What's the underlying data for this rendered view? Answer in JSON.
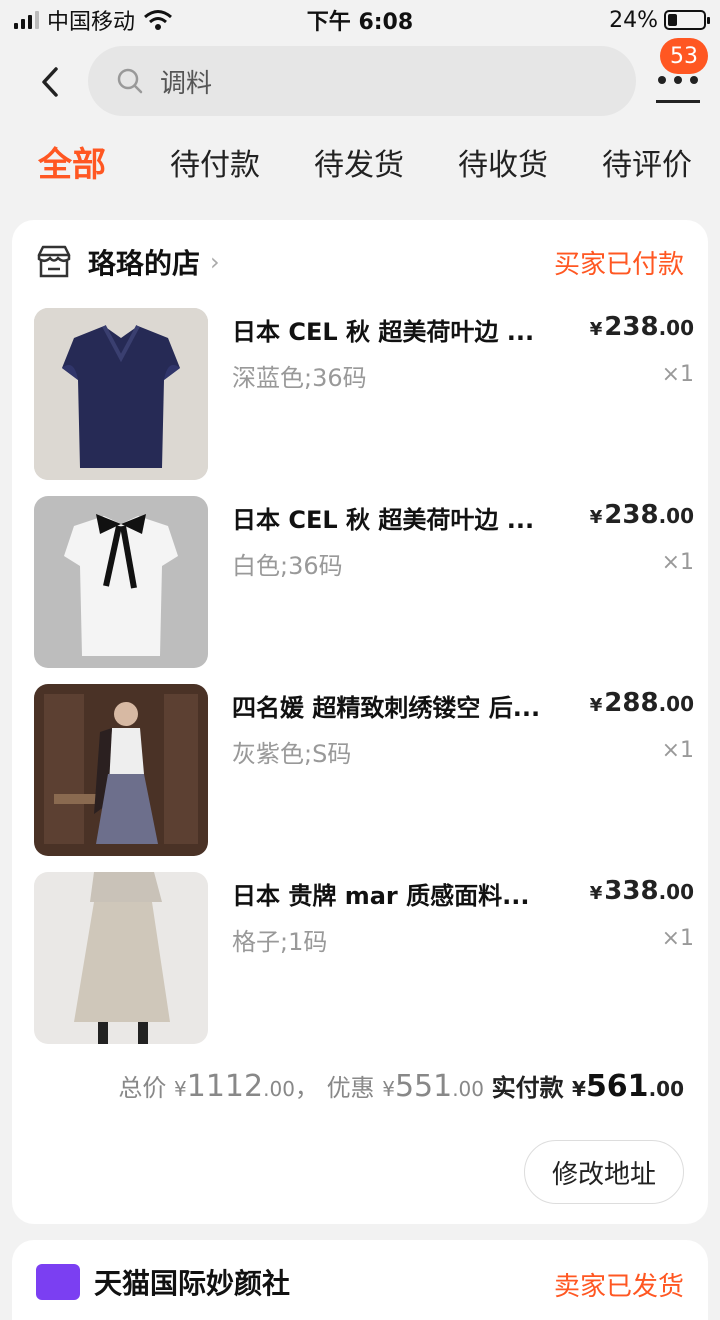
{
  "status_bar": {
    "carrier": "中国移动",
    "time": "下午 6:08",
    "battery": "24%",
    "battery_level": 0.24
  },
  "header": {
    "search_value": "调料",
    "badge_count": "53"
  },
  "tabs": [
    {
      "label": "全部",
      "active": true
    },
    {
      "label": "待付款",
      "active": false
    },
    {
      "label": "待发货",
      "active": false
    },
    {
      "label": "待收货",
      "active": false
    },
    {
      "label": "待评价",
      "active": false
    }
  ],
  "order": {
    "shop_name": "珞珞的店",
    "status": "买家已付款",
    "items": [
      {
        "title": "日本 CEL 秋 超美荷叶边 ...",
        "spec": "深蓝色;36码",
        "price_int": "238",
        "price_dec": ".00",
        "qty": "×1"
      },
      {
        "title": "日本 CEL 秋 超美荷叶边 ...",
        "spec": "白色;36码",
        "price_int": "238",
        "price_dec": ".00",
        "qty": "×1"
      },
      {
        "title": "四名媛 超精致刺绣镂空 后...",
        "spec": "灰紫色;S码",
        "price_int": "288",
        "price_dec": ".00",
        "qty": "×1"
      },
      {
        "title": "日本 贵牌 mar 质感面料...",
        "spec": "格子;1码",
        "price_int": "338",
        "price_dec": ".00",
        "qty": "×1"
      }
    ],
    "currency": "¥",
    "total_label": "总价",
    "total_int": "1112",
    "total_dec": ".00",
    "discount_label": "优惠",
    "discount_int": "551",
    "discount_dec": ".00",
    "paid_label": "实付款",
    "paid_int": "561",
    "paid_dec": ".00",
    "modify_button": "修改地址"
  },
  "next_order": {
    "shop_name": "天猫国际妙颜社",
    "status": "卖家已发货"
  },
  "colors": {
    "accent": "#ff5722",
    "background": "#f2f2f2"
  }
}
